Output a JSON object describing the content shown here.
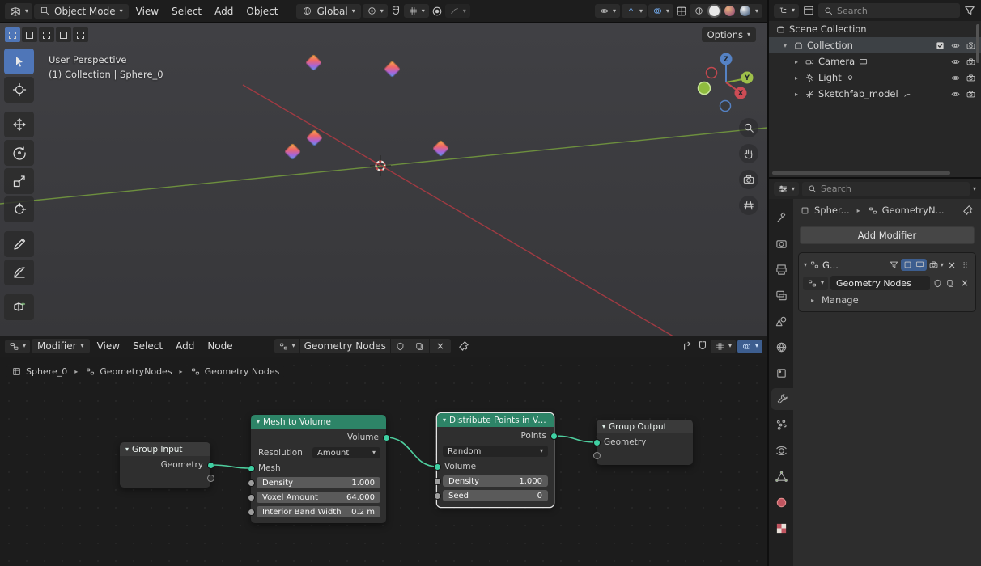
{
  "viewport_header": {
    "mode_label": "Object Mode",
    "menus": [
      "View",
      "Select",
      "Add",
      "Object"
    ],
    "orientation_label": "Global",
    "options_label": "Options"
  },
  "viewport": {
    "perspective_label": "User Perspective",
    "context_label": "(1) Collection | Sphere_0",
    "axis_x_label": "X",
    "axis_y_label": "Y",
    "axis_z_label": "Z"
  },
  "outliner": {
    "search_placeholder": "Search",
    "scene_collection_label": "Scene Collection",
    "collection_label": "Collection",
    "camera_label": "Camera",
    "light_label": "Light",
    "model_label": "Sketchfab_model"
  },
  "properties": {
    "search_placeholder": "Search",
    "breadcrumb_object": "Spher...",
    "breadcrumb_nodetree": "GeometryN...",
    "add_modifier_label": "Add Modifier",
    "modifier_title": "G...",
    "node_group_name": "Geometry Nodes",
    "manage_label": "Manage"
  },
  "node_editor": {
    "mode_label": "Modifier",
    "menus": [
      "View",
      "Select",
      "Add",
      "Node"
    ],
    "datablock_name": "Geometry Nodes",
    "path": [
      "Sphere_0",
      "GeometryNodes",
      "Geometry Nodes"
    ]
  },
  "nodes": {
    "group_input": {
      "title": "Group Input",
      "output_label": "Geometry"
    },
    "mesh_to_volume": {
      "title": "Mesh to Volume",
      "output_label": "Volume",
      "resolution_label": "Resolution",
      "resolution_value": "Amount",
      "input_label": "Mesh",
      "fields": [
        {
          "label": "Density",
          "value": "1.000"
        },
        {
          "label": "Voxel Amount",
          "value": "64.000"
        },
        {
          "label": "Interior Band Width",
          "value": "0.2 m"
        }
      ]
    },
    "distribute_points": {
      "title": "Distribute Points in Volu...",
      "output_label": "Points",
      "method_value": "Random",
      "input_label": "Volume",
      "fields": [
        {
          "label": "Density",
          "value": "1.000"
        },
        {
          "label": "Seed",
          "value": "0"
        }
      ]
    },
    "group_output": {
      "title": "Group Output",
      "input_label": "Geometry"
    }
  }
}
